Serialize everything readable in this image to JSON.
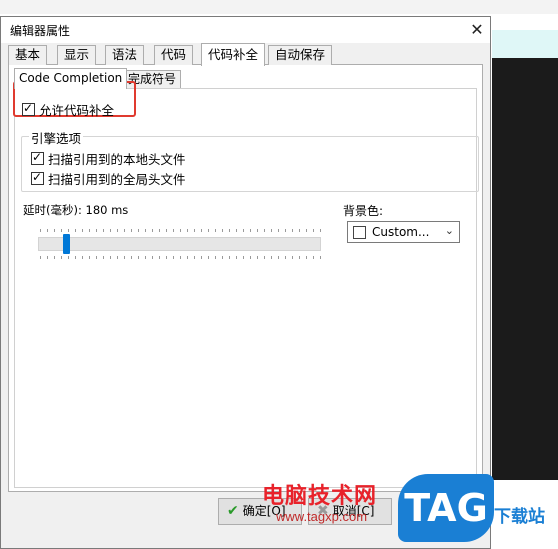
{
  "dialog": {
    "title": "编辑器属性",
    "close_glyph": "✕"
  },
  "main_tabs": [
    {
      "label": "基本"
    },
    {
      "label": "显示"
    },
    {
      "label": "语法"
    },
    {
      "label": "代码"
    },
    {
      "label": "代码补全"
    },
    {
      "label": "自动保存"
    }
  ],
  "active_main_tab": "代码补全",
  "sub_tabs": [
    {
      "label": "Code Completion"
    },
    {
      "label": "完成符号"
    }
  ],
  "active_sub_tab": "Code Completion",
  "options": {
    "enable_completion": {
      "label": "允许代码补全",
      "checked": true
    },
    "engine_group_title": "引擎选项",
    "scan_local_headers": {
      "label": "扫描引用到的本地头文件",
      "checked": true
    },
    "scan_global_headers": {
      "label": "扫描引用到的全局头文件",
      "checked": true
    }
  },
  "delay": {
    "label": "延时(毫秒): 180 ms",
    "value_ms": 180
  },
  "background_color": {
    "label": "背景色:",
    "value": "Custom..."
  },
  "buttons": {
    "ok_label": "确定[O]",
    "cancel_label": "取消[C]"
  },
  "watermark": {
    "brand": "电脑技术网",
    "url": "www.tagxp.com",
    "logo": "TAG",
    "suffix": "下载站"
  },
  "colors": {
    "accent": "#0078d7",
    "highlight": "#e03a2f"
  },
  "icons": {
    "ok": "check-icon",
    "cancel": "x-icon",
    "close": "close-icon",
    "dropdown": "chevron-down-icon"
  }
}
